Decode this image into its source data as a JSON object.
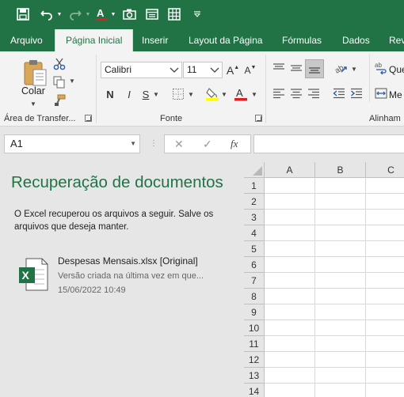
{
  "quick_access": {
    "icons": [
      "save-icon",
      "undo-icon",
      "redo-icon",
      "font-color-icon",
      "camera-icon",
      "form-icon",
      "table-icon",
      "customize-icon"
    ]
  },
  "tabs": [
    {
      "label": "Arquivo",
      "active": false
    },
    {
      "label": "Página Inicial",
      "active": true
    },
    {
      "label": "Inserir",
      "active": false
    },
    {
      "label": "Layout da Página",
      "active": false
    },
    {
      "label": "Fórmulas",
      "active": false
    },
    {
      "label": "Dados",
      "active": false
    },
    {
      "label": "Rev",
      "active": false
    }
  ],
  "ribbon": {
    "clipboard": {
      "paste_label": "Colar",
      "group_label": "Área de Transfer..."
    },
    "font": {
      "font_name": "Calibri",
      "font_size": "11",
      "bold": "N",
      "italic": "I",
      "underline": "S",
      "group_label": "Fonte"
    },
    "alignment": {
      "wrap_label": "Que",
      "merge_label": "Me",
      "group_label": "Alinham"
    }
  },
  "formula_bar": {
    "name_box": "A1",
    "cancel": "✕",
    "enter": "✓",
    "fx": "fx"
  },
  "recovery": {
    "title": "Recuperação de documentos",
    "message": "O Excel recuperou os arquivos a seguir. Salve os arquivos que deseja manter.",
    "file": {
      "name": "Despesas Mensais.xlsx  [Original]",
      "description": "Versão criada na última vez em que...",
      "date": "15/06/2022 10:49"
    }
  },
  "grid": {
    "columns": [
      "A",
      "B",
      "C"
    ],
    "rows": [
      "1",
      "2",
      "3",
      "4",
      "5",
      "6",
      "7",
      "8",
      "9",
      "10",
      "11",
      "12",
      "13",
      "14"
    ]
  }
}
